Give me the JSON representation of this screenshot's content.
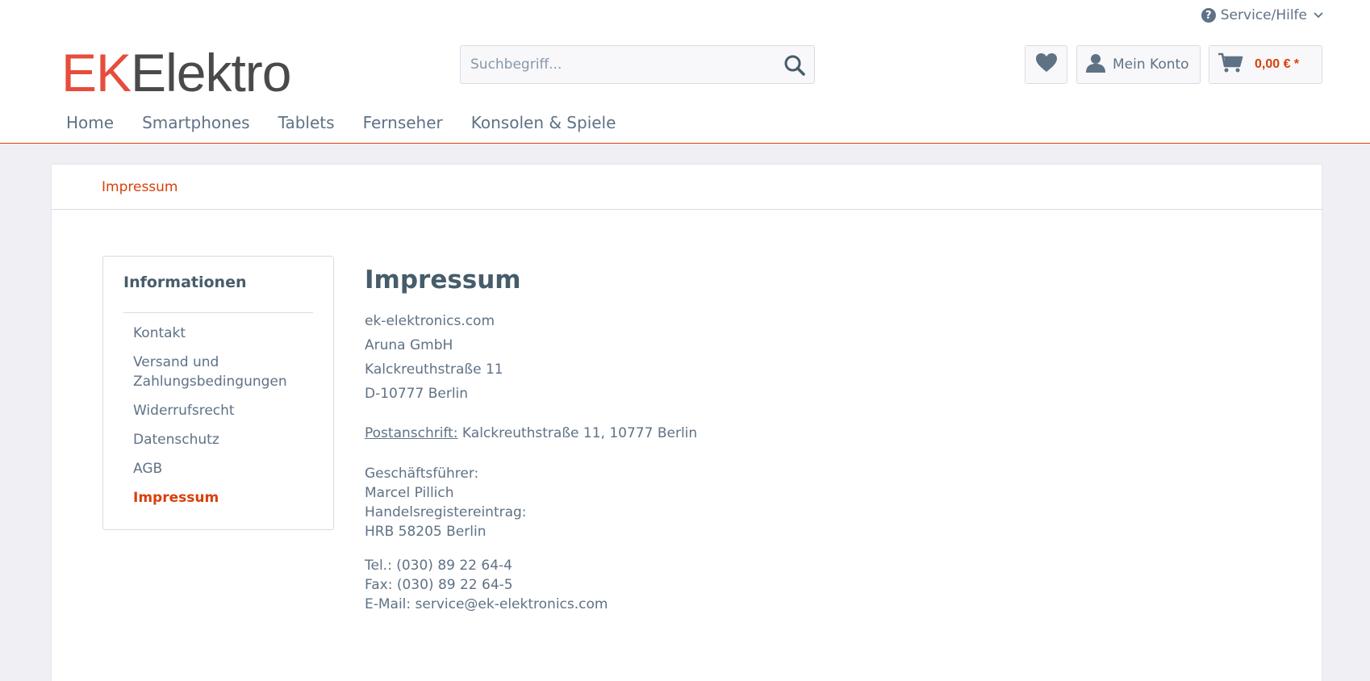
{
  "header": {
    "service_label": "Service/Hilfe",
    "logo_part1": "EK",
    "logo_part2": "Elektro",
    "search_placeholder": "Suchbegriff...",
    "account_label": "Mein Konto",
    "cart_total": "0,00 € *"
  },
  "nav": [
    "Home",
    "Smartphones",
    "Tablets",
    "Fernseher",
    "Konsolen & Spiele"
  ],
  "breadcrumb": "Impressum",
  "sidebar": {
    "title": "Informationen",
    "items": [
      {
        "label": "Kontakt",
        "active": false
      },
      {
        "label": "Versand und Zahlungsbedingungen",
        "active": false
      },
      {
        "label": "Widerrufsrecht",
        "active": false
      },
      {
        "label": "Datenschutz",
        "active": false
      },
      {
        "label": "AGB",
        "active": false
      },
      {
        "label": "Impressum",
        "active": true
      }
    ]
  },
  "content": {
    "title": "Impressum",
    "address": [
      "ek-elektronics.com",
      "Aruna GmbH",
      "Kalckreuthstraße 11",
      "D-10777 Berlin"
    ],
    "postal_label": "Postanschrift:",
    "postal_value": " Kalckreuthstraße 11, 10777 Berlin",
    "management": [
      "Geschäftsführer:",
      "Marcel Pillich",
      "Handelsregistereintrag:",
      "HRB 58205 Berlin"
    ],
    "contact": [
      "Tel.: (030) 89 22 64-4",
      "Fax: (030) 89 22 64-5",
      "E-Mail: service@ek-elektronics.com"
    ]
  },
  "colors": {
    "accent": "#d9400b",
    "logo_red": "#e74c3c",
    "text": "#5f7285",
    "heading": "#475c6a",
    "background": "#f0f0f4"
  },
  "icons": [
    "question-circle-icon",
    "chevron-down-icon",
    "search-icon",
    "heart-icon",
    "user-icon",
    "cart-icon"
  ]
}
